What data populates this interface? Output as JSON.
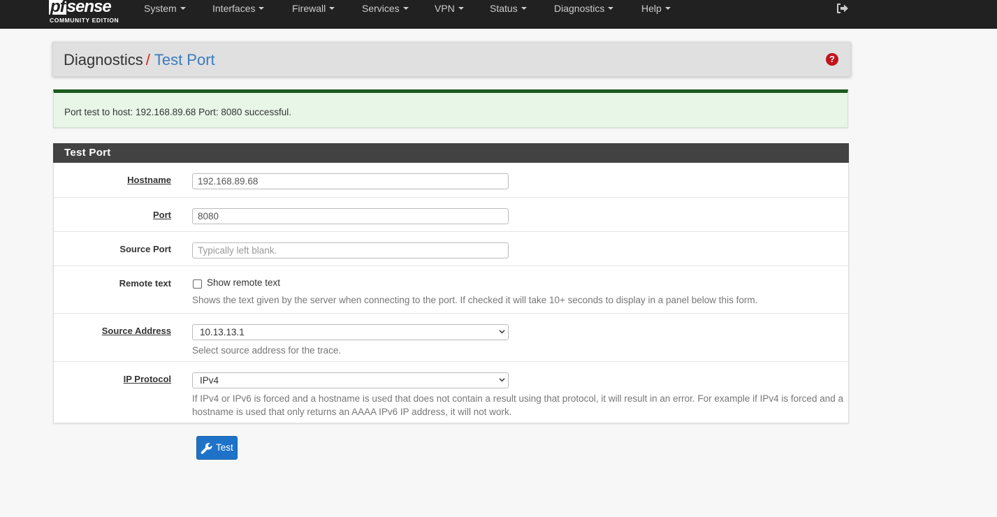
{
  "navbar": {
    "logo_main": "sense",
    "logo_pf": "pf",
    "logo_sub": "COMMUNITY EDITION",
    "items": [
      {
        "label": "System"
      },
      {
        "label": "Interfaces"
      },
      {
        "label": "Firewall"
      },
      {
        "label": "Services"
      },
      {
        "label": "VPN"
      },
      {
        "label": "Status"
      },
      {
        "label": "Diagnostics"
      },
      {
        "label": "Help"
      }
    ],
    "logout_icon": "sign-out-icon"
  },
  "breadcrumb": {
    "parent": "Diagnostics",
    "separator": "/",
    "current": "Test Port",
    "help_icon": "question-circle-icon",
    "help_symbol": "?"
  },
  "alert": {
    "message": "Port test to host: 192.168.89.68 Port: 8080 successful."
  },
  "form": {
    "title": "Test Port",
    "hostname": {
      "label": "Hostname",
      "value": "192.168.89.68"
    },
    "port": {
      "label": "Port",
      "value": "8080"
    },
    "source_port": {
      "label": "Source Port",
      "value": "",
      "placeholder": "Typically left blank."
    },
    "remote_text": {
      "label": "Remote text",
      "checkbox_label": "Show remote text",
      "checked": false,
      "hint": "Shows the text given by the server when connecting to the port. If checked it will take 10+ seconds to display in a panel below this form."
    },
    "source_address": {
      "label": "Source Address",
      "value": "10.13.13.1",
      "hint": "Select source address for the trace."
    },
    "ip_protocol": {
      "label": "IP Protocol",
      "value": "IPv4",
      "hint": "If IPv4 or IPv6 is forced and a hostname is used that does not contain a result using that protocol, it will result in an error. For example if IPv4 is forced and a hostname is used that only returns an AAAA IPv6 IP address, it will not work."
    },
    "submit_label": "Test",
    "submit_icon": "wrench-icon"
  },
  "colors": {
    "navbar_bg": "#212121",
    "accent_red": "#d9241b",
    "link_blue": "#3a7bbf",
    "success_border": "#1e5a1e",
    "success_bg": "#e8f6e8",
    "panel_header_bg": "#424242",
    "button_blue": "#1e73c9"
  }
}
